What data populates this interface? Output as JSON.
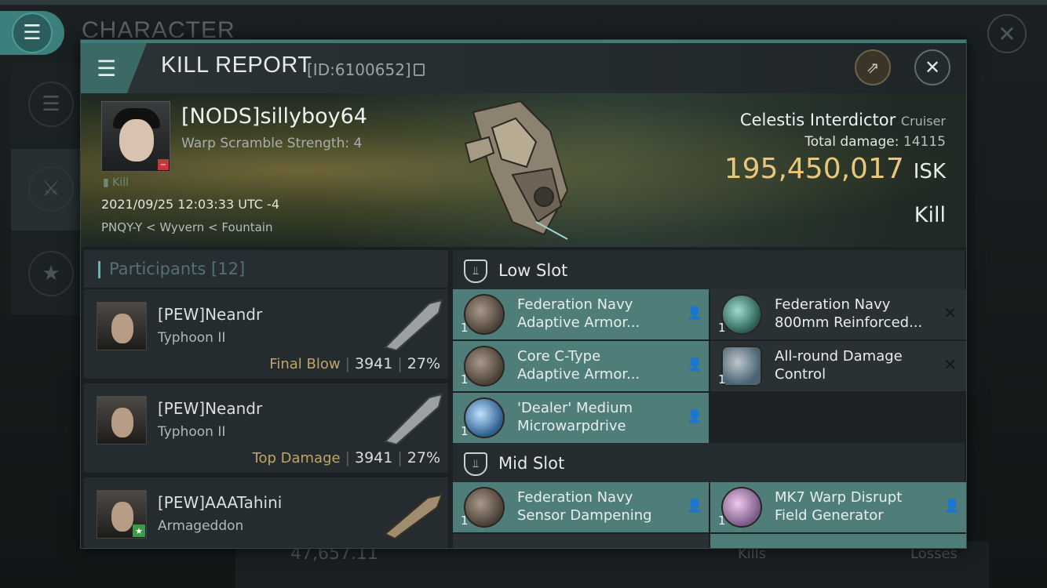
{
  "background": {
    "title": "CHARACTER",
    "isk_value": "47,657.11",
    "kills_label": "Kills",
    "losses_label": "Losses"
  },
  "panel": {
    "title": "KILL REPORT",
    "id_text": "[ID:6100652]"
  },
  "victim": {
    "name": "[NODS]sillyboy64",
    "subtitle": "Warp Scramble Strength: 4",
    "tag": "Kill",
    "datetime": "2021/09/25 12:03:33 UTC -4",
    "location": "PNQY-Y < Wyvern < Fountain"
  },
  "ship": {
    "name": "Celestis Interdictor",
    "class": "Cruiser",
    "total_damage_label": "Total damage:",
    "total_damage_value": "14115",
    "isk_value": "195,450,017",
    "isk_unit": "ISK",
    "result": "Kill"
  },
  "participants": {
    "label": "Participants",
    "count": "[12]",
    "rows": [
      {
        "name": "[PEW]Neandr",
        "ship": "Typhoon II",
        "tag": "Final Blow",
        "damage": "3941",
        "percent": "27%"
      },
      {
        "name": "[PEW]Neandr",
        "ship": "Typhoon II",
        "tag": "Top Damage",
        "damage": "3941",
        "percent": "27%"
      },
      {
        "name": "[PEW]AAATahini",
        "ship": "Armageddon",
        "tag": "",
        "damage": "",
        "percent": ""
      }
    ]
  },
  "low_slot": {
    "label": "Low Slot",
    "modules": [
      {
        "qty": "1",
        "name1": "Federation Navy",
        "name2": "Adaptive Armor...",
        "icon": "armor-icon"
      },
      {
        "qty": "1",
        "name1": "Federation Navy",
        "name2": "800mm Reinforced...",
        "icon": "plate-icon"
      },
      {
        "qty": "1",
        "name1": "Core C-Type",
        "name2": "Adaptive Armor...",
        "icon": "armor-icon"
      },
      {
        "qty": "1",
        "name1": "All-round Damage",
        "name2": "Control",
        "icon": "damage-control-icon"
      },
      {
        "qty": "1",
        "name1": "'Dealer' Medium",
        "name2": "Microwarpdrive",
        "icon": "microwarpdrive-icon"
      }
    ]
  },
  "mid_slot": {
    "label": "Mid Slot",
    "modules": [
      {
        "qty": "1",
        "name1": "Federation Navy",
        "name2": "Sensor Dampening",
        "icon": "sensor-damp-icon"
      },
      {
        "qty": "1",
        "name1": "MK7 Warp Disrupt",
        "name2": "Field Generator",
        "icon": "warp-disrupt-icon"
      }
    ]
  },
  "colors": {
    "accent": "#4f7e7a",
    "isk_gold": "#e8c77d"
  }
}
